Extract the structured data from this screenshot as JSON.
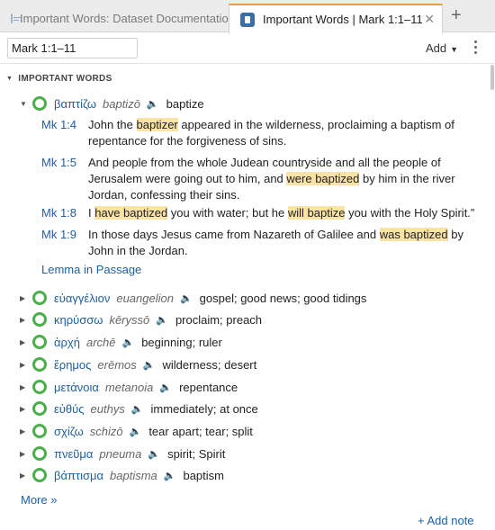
{
  "tabs": [
    {
      "label": "Important Words: Dataset Documentation",
      "active": false
    },
    {
      "label": "Important Words | Mark 1:1–11",
      "active": true
    }
  ],
  "tab_close": "✕",
  "tab_add": "+",
  "reference": {
    "value": "Mark 1:1–11"
  },
  "add_menu": {
    "label": "Add",
    "caret": "▼"
  },
  "section": {
    "caret": "▼",
    "title": "IMPORTANT WORDS"
  },
  "speaker_glyph": "🔈",
  "caret_expanded": "▼",
  "caret_collapsed": "▶",
  "expanded_word": {
    "lemma": "βαπτίζω",
    "translit": "baptizō",
    "gloss": "baptize",
    "verses": [
      {
        "ref": "Mk 1:4",
        "parts": [
          "John the ",
          "baptizer",
          " appeared in the wilderness, proclaiming a baptism of repentance for the forgiveness of sins."
        ]
      },
      {
        "ref": "Mk 1:5",
        "parts": [
          "And people from the whole Judean countryside and all the people of Jerusalem were going out to him, and ",
          "were baptized",
          " by him in the river Jordan, confessing their sins."
        ]
      },
      {
        "ref": "Mk 1:8",
        "parts": [
          "I ",
          "have baptized",
          " you with water; but he ",
          "will baptize",
          " you with the Holy Spirit.”"
        ]
      },
      {
        "ref": "Mk 1:9",
        "parts": [
          "In those days Jesus came from Nazareth of Galilee and ",
          "was baptized",
          " by John in the Jordan."
        ]
      }
    ],
    "lemma_link": "Lemma in Passage"
  },
  "words": [
    {
      "lemma": "εὐαγγέλιον",
      "translit": "euangelion",
      "gloss": "gospel; good news; good tidings"
    },
    {
      "lemma": "κηρύσσω",
      "translit": "kēryssō",
      "gloss": "proclaim; preach"
    },
    {
      "lemma": "ἀρχή",
      "translit": "archē",
      "gloss": "beginning; ruler"
    },
    {
      "lemma": "ἔρημος",
      "translit": "erēmos",
      "gloss": "wilderness; desert"
    },
    {
      "lemma": "μετάνοια",
      "translit": "metanoia",
      "gloss": "repentance"
    },
    {
      "lemma": "εὐθύς",
      "translit": "euthys",
      "gloss": "immediately; at once"
    },
    {
      "lemma": "σχίζω",
      "translit": "schizō",
      "gloss": "tear apart; tear; split"
    },
    {
      "lemma": "πνεῦμα",
      "translit": "pneuma",
      "gloss": "spirit; Spirit"
    },
    {
      "lemma": "βάπτισμα",
      "translit": "baptisma",
      "gloss": "baptism"
    }
  ],
  "more_link": "More »",
  "add_note": "+ Add note",
  "colors": {
    "accent": "#e9a13b",
    "link": "#1e5fa5",
    "ring": "#4cae4c",
    "highlight": "#fbe3a6"
  }
}
